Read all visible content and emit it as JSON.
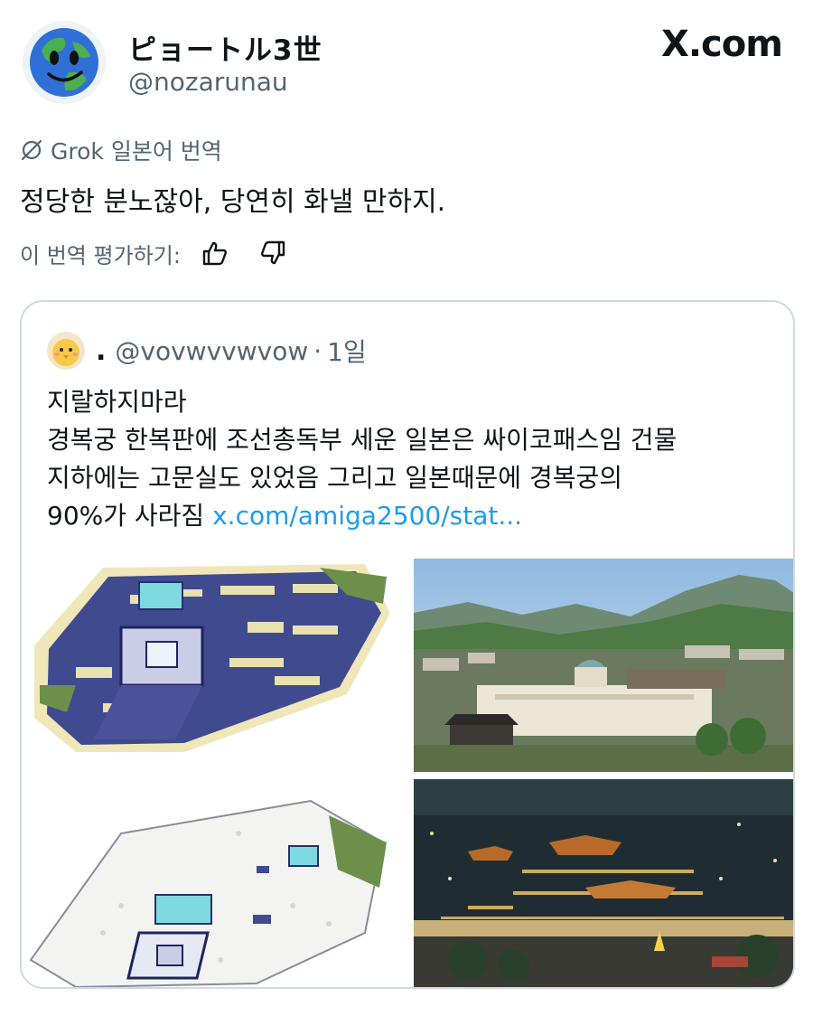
{
  "header": {
    "display_name": "ピョートル3世",
    "handle": "@nozarunau",
    "brand": "X.com"
  },
  "translation": {
    "source_label": "Grok 일본어 번역",
    "text": "정당한 분노잖아, 당연히 화낼 만하지.",
    "rate_label": "이 번역 평가하기:"
  },
  "quote": {
    "name": ".",
    "handle": "@vovwvvwvow",
    "separator": "·",
    "time": "1일",
    "lines": [
      "지랄하지마라",
      "경복궁 한복판에 조선총독부 세운 일본은 싸이코패스임 건물",
      "지하에는 고문실도 있었음 그리고 일본때문에 경복궁의"
    ],
    "last_line_text": "90%가 사라짐",
    "link_text": "x.com/amiga2500/stat..."
  },
  "colors": {
    "text": "#0f1419",
    "secondary": "#536471",
    "link": "#1d9bf0",
    "border": "#cfd9de"
  },
  "icons": {
    "translation": "grok-icon",
    "like": "thumbs-up-icon",
    "dislike": "thumbs-down-icon"
  }
}
